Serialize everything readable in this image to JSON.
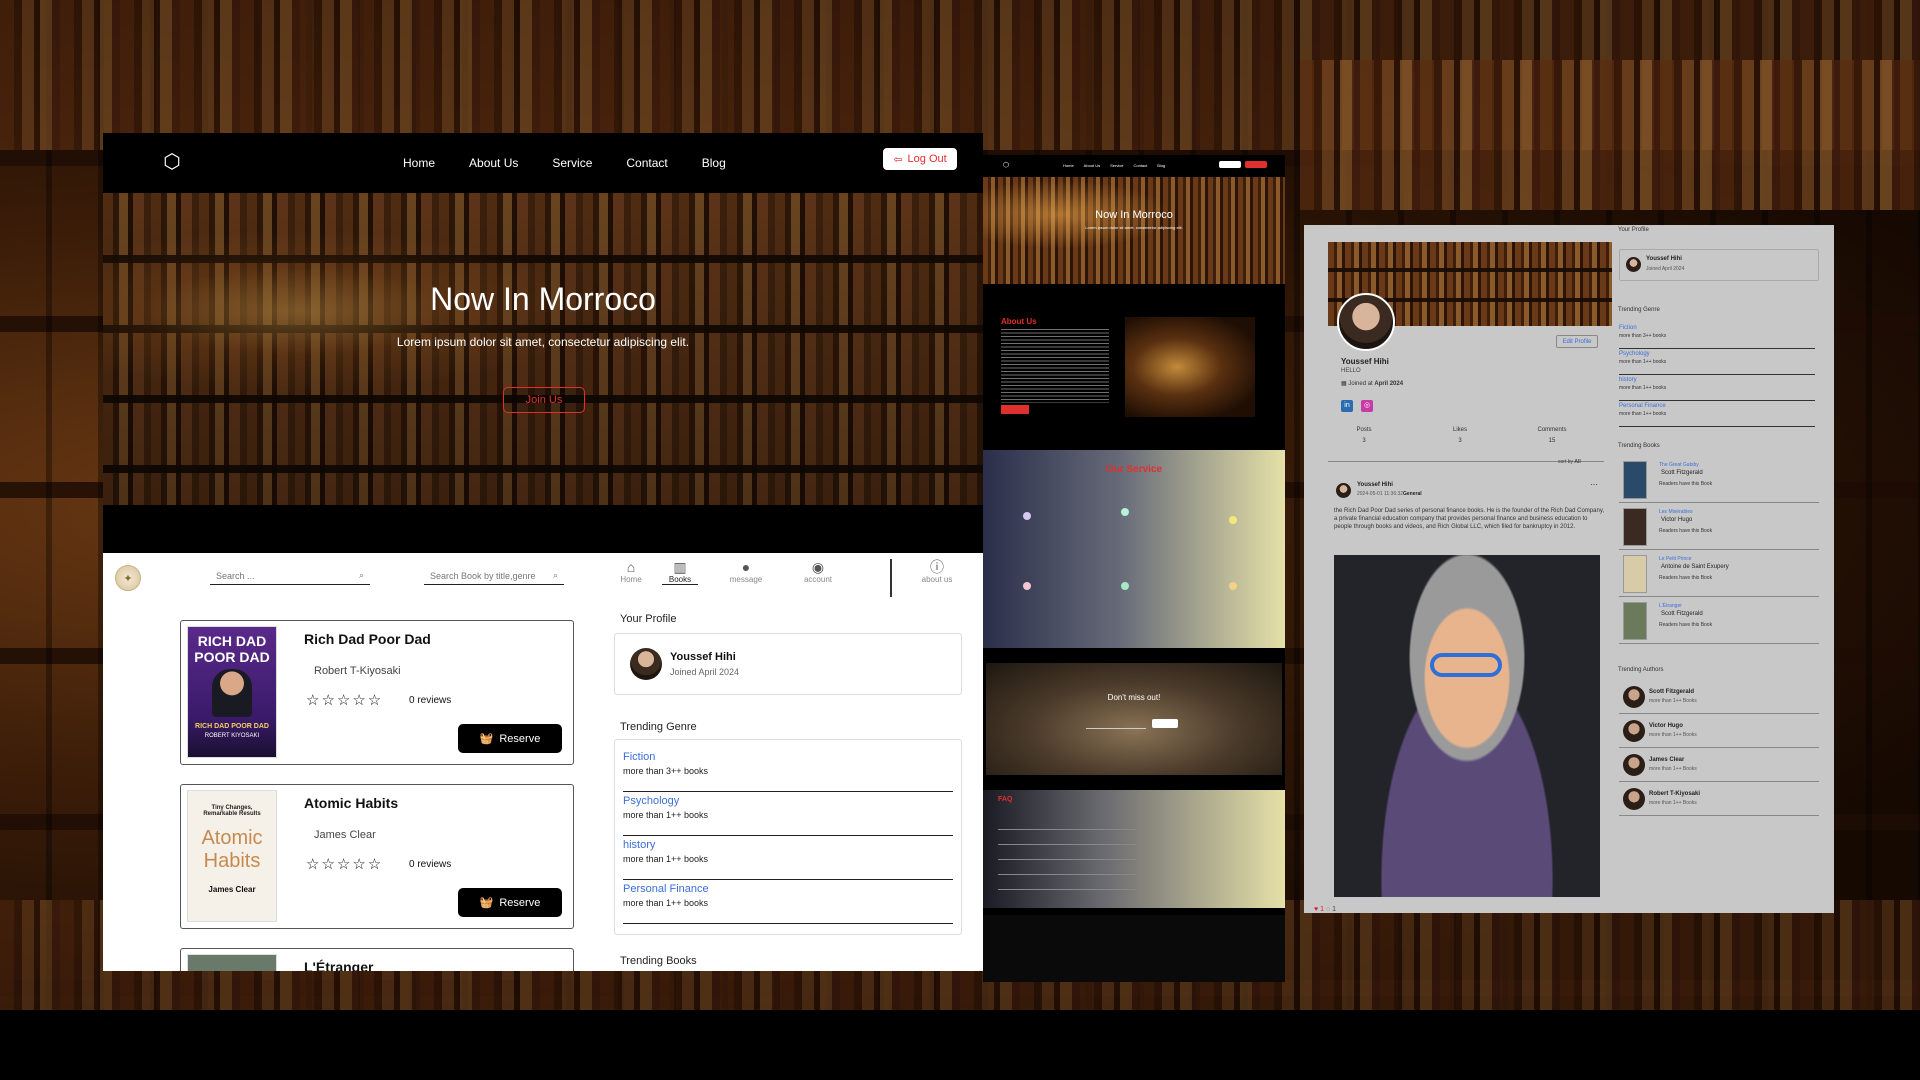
{
  "website": {
    "nav": {
      "items": [
        "Home",
        "About Us",
        "Service",
        "Contact",
        "Blog"
      ],
      "logout": "Log Out"
    },
    "hero": {
      "title": "Now In Morroco",
      "subtitle": "Lorem ipsum dolor sit amet, consectetur adipiscing elit.",
      "cta": "Join Us"
    }
  },
  "library_app": {
    "search_placeholder": "Search ...",
    "search_by_placeholder": "Search Book by title,genre",
    "nav": [
      {
        "label": "Home",
        "icon": "home-icon"
      },
      {
        "label": "Books",
        "icon": "books-icon",
        "active": true
      },
      {
        "label": "message",
        "icon": "message-icon"
      },
      {
        "label": "account",
        "icon": "account-icon"
      },
      {
        "label": "about us",
        "icon": "info-icon"
      }
    ],
    "books": [
      {
        "title": "Rich Dad Poor Dad",
        "author": "Robert T-Kiyosaki",
        "reviews": "0 reviews",
        "rating": 0,
        "reserve": "Reserve",
        "cover": {
          "line1": "RICH DAD",
          "line2": "POOR DAD",
          "bottom": "RICH DAD POOR DAD",
          "author": "ROBERT KIYOSAKI"
        }
      },
      {
        "title": "Atomic Habits",
        "author": "James Clear",
        "reviews": "0 reviews",
        "rating": 0,
        "reserve": "Reserve",
        "cover": {
          "top": "Tiny Changes, Remarkable Results",
          "line1": "Atomic",
          "line2": "Habits",
          "author": "James Clear"
        }
      },
      {
        "title": "L'Étranger"
      }
    ],
    "profile": {
      "heading": "Your Profile",
      "name": "Youssef Hihi",
      "joined": "Joined April 2024"
    },
    "trending_genre": {
      "heading": "Trending Genre",
      "items": [
        {
          "name": "Fiction",
          "count": "more than 3++ books"
        },
        {
          "name": "Psychology",
          "count": "more than 1++ books"
        },
        {
          "name": "history",
          "count": "more than 1++ books"
        },
        {
          "name": "Personal Finance",
          "count": "more than 1++ books"
        }
      ]
    },
    "trending_books_heading": "Trending Books"
  },
  "landing_preview": {
    "hero_title": "Now In Morroco",
    "about_title": "About Us",
    "service_title": "Our Service",
    "cta_title": "Don't miss out!",
    "faq_title": "FAQ"
  },
  "profile_page": {
    "name": "Youssef Hihi",
    "bio": "HELLO",
    "joined_prefix": "Joined at ",
    "joined_date": "April 2024",
    "edit_button": "Edit Profile",
    "stats": [
      {
        "label": "Posts",
        "value": "3"
      },
      {
        "label": "Likes",
        "value": "3"
      },
      {
        "label": "Comments",
        "value": "15"
      }
    ],
    "sort_label": "sort by",
    "sort_value": "All",
    "post": {
      "author": "Youssef Hihi",
      "date": "2024-05-01 11:36:32",
      "genre": "General",
      "text": "the Rich Dad Poor Dad series of personal finance books. He is the founder of the Rich Dad Company, a private financial education company that provides personal finance and business education to people through books and videos, and Rich Global LLC, which filed for bankruptcy in 2012.",
      "likes": "1",
      "comments": "1"
    },
    "side": {
      "profile_heading": "Your Profile",
      "profile_name": "Youssef Hihi",
      "profile_joined": "Joined April 2024",
      "genre_heading": "Trending Genre",
      "genres": [
        {
          "name": "Fiction",
          "count": "more than 3++ books"
        },
        {
          "name": "Psychology",
          "count": "more than 1++ books"
        },
        {
          "name": "history",
          "count": "more than 1++ books"
        },
        {
          "name": "Personal Finance",
          "count": "more than 1++ books"
        }
      ],
      "books_heading": "Trending Books",
      "books": [
        {
          "title": "The Great Gatsby",
          "author": "Scott Fitzgerald",
          "readers": "Readers have this Book"
        },
        {
          "title": "Les Misérables",
          "author": "Victor Hugo",
          "readers": "Readers have this Book"
        },
        {
          "title": "Le Petit Prince",
          "author": "Antoine de Saint Exupery",
          "readers": "Readers have this Book"
        },
        {
          "title": "L'Étranger",
          "author": "Scott Fitzgerald",
          "readers": "Readers have this Book"
        }
      ],
      "authors_heading": "Trending Authors",
      "authors": [
        {
          "name": "Scott Fitzgerald",
          "count": "more than 1++ Books"
        },
        {
          "name": "Victor Hugo",
          "count": "more than 1++ Books"
        },
        {
          "name": "James Clear",
          "count": "more than 1++ Books"
        },
        {
          "name": "Robert T-Kiyosaki",
          "count": "more than 1++ Books"
        }
      ]
    }
  },
  "colors": {
    "accent": "#e0302e",
    "link": "#3b6fd8"
  }
}
